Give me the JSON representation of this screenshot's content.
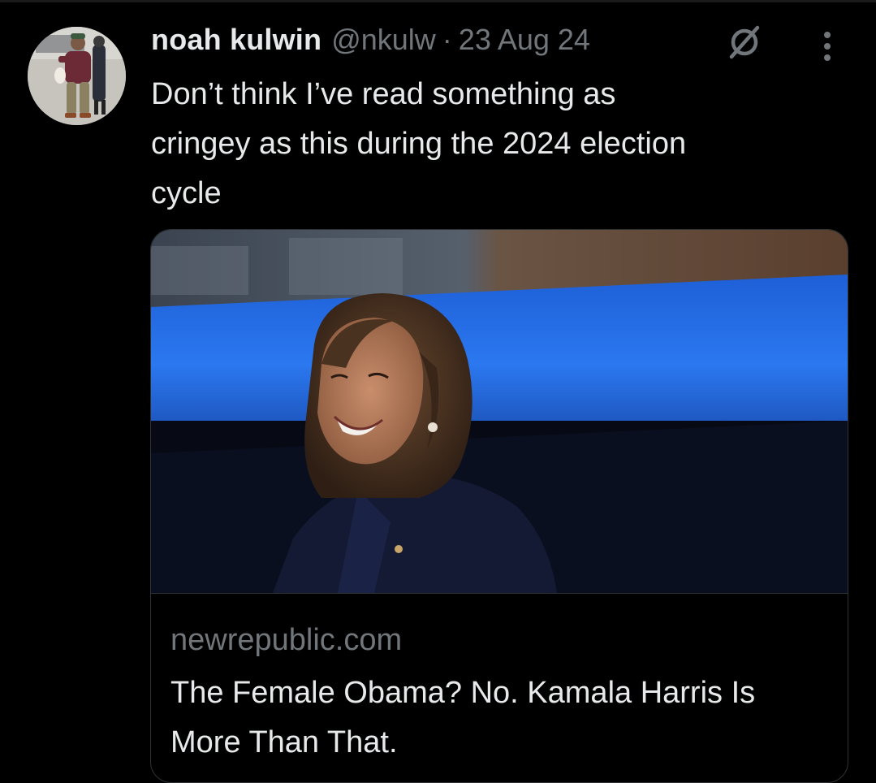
{
  "tweet": {
    "display_name": "noah kulwin",
    "handle": "@nkulw",
    "separator": "·",
    "date": "23 Aug 24",
    "text": "Don’t think I’ve read something as\ncringey as this during the 2024 election\ncycle",
    "avatar_icon": "user-avatar-photo",
    "status_icon": "slashed-circle-icon",
    "menu_icon": "more-vertical-icon"
  },
  "link_card": {
    "image_icon": "article-photo",
    "domain": "newrepublic.com",
    "title": "The Female Obama? No. Kamala Harris Is More Than That."
  },
  "colors": {
    "background": "#000000",
    "primary_text": "#e7e9ea",
    "secondary_text": "#71767b",
    "border": "#2f3336"
  }
}
